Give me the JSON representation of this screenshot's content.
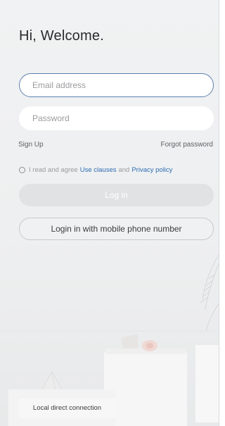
{
  "header": {
    "title": "Hi, Welcome."
  },
  "form": {
    "email_placeholder": "Email address",
    "password_placeholder": "Password",
    "sign_up": "Sign Up",
    "forgot_password": "Forgot password",
    "agreement": {
      "prefix": "I read and agree",
      "use_clauses": "Use clauses",
      "and": "and",
      "privacy_policy": "Privacy policy",
      "checked": false
    },
    "login_button": "Log in",
    "mobile_login_button": "Login in with mobile phone number"
  },
  "footer": {
    "local_connection": "Local direct connection"
  },
  "colors": {
    "accent_border": "#5b7fae",
    "link_blue": "#2e6db4",
    "disabled_button": "#e1e2e4"
  },
  "icons": {
    "agreement_checkbox": "radio-circle-icon"
  }
}
